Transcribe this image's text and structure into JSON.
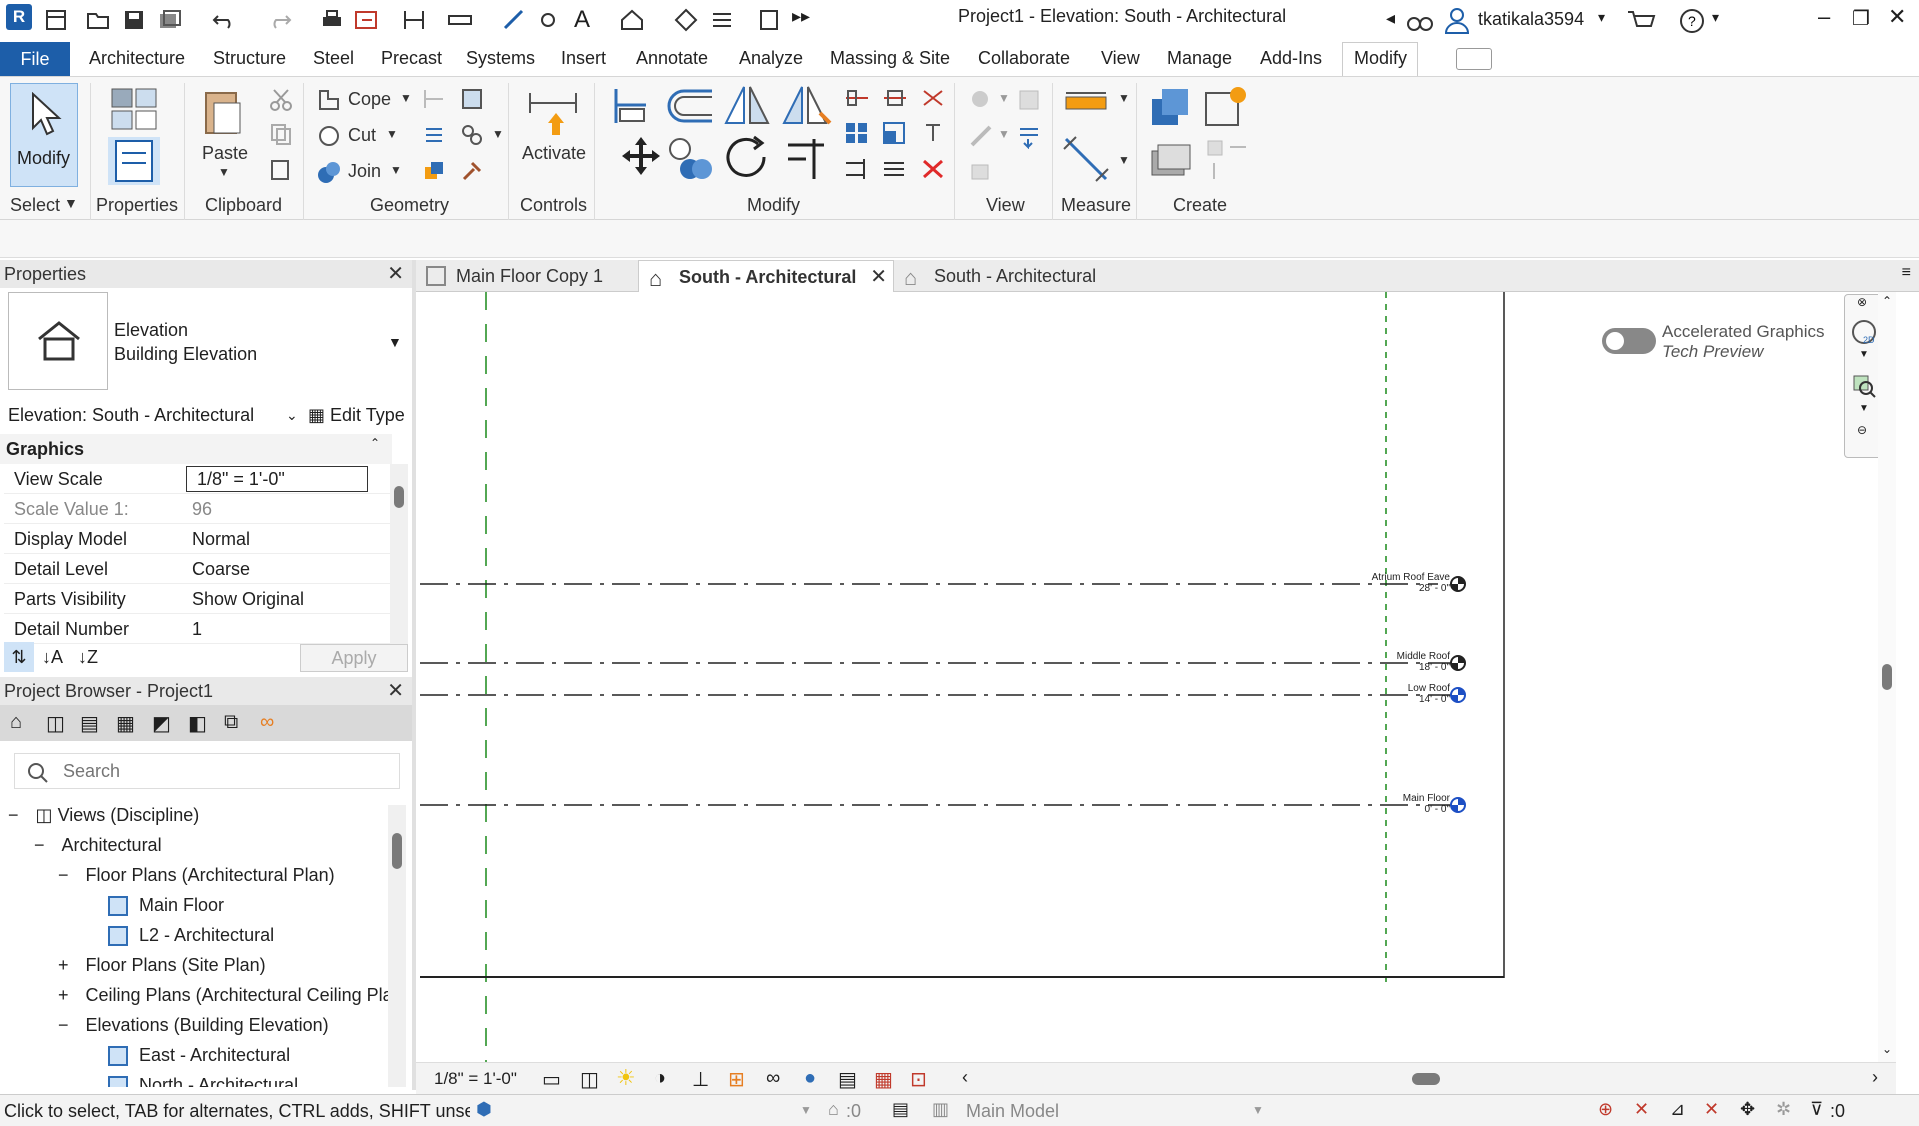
{
  "app": {
    "title": "Project1 - Elevation: South - Architectural",
    "user": "tkatikala3594"
  },
  "menu": {
    "file": "File",
    "items": [
      "Architecture",
      "Structure",
      "Steel",
      "Precast",
      "Systems",
      "Insert",
      "Annotate",
      "Analyze",
      "Massing & Site",
      "Collaborate",
      "View",
      "Manage",
      "Add-Ins",
      "Modify"
    ],
    "active": "Modify"
  },
  "ribbon": {
    "modify_btn": "Modify",
    "select": "Select",
    "properties": "Properties",
    "paste": "Paste",
    "clipboard": "Clipboard",
    "cope": "Cope",
    "cut": "Cut",
    "join": "Join",
    "geometry": "Geometry",
    "activate": "Activate",
    "controls": "Controls",
    "modify_panel": "Modify",
    "view": "View",
    "measure": "Measure",
    "create": "Create"
  },
  "properties": {
    "header": "Properties",
    "type_name": "Elevation",
    "type_sub": "Building Elevation",
    "instance": "Elevation: South - Architectural",
    "edit_type": "Edit Type",
    "group": "Graphics",
    "rows": [
      {
        "key": "View Scale",
        "value": "1/8\" = 1'-0\""
      },
      {
        "key": "Scale Value    1:",
        "value": "96"
      },
      {
        "key": "Display Model",
        "value": "Normal"
      },
      {
        "key": "Detail Level",
        "value": "Coarse"
      },
      {
        "key": "Parts Visibility",
        "value": "Show Original"
      },
      {
        "key": "Detail Number",
        "value": "1"
      }
    ],
    "apply": "Apply"
  },
  "browser": {
    "header": "Project Browser - Project1",
    "search_placeholder": "Search",
    "tree": [
      {
        "label": "Views (Discipline)",
        "depth": 0,
        "toggle": "−"
      },
      {
        "label": "Architectural",
        "depth": 1,
        "toggle": "−"
      },
      {
        "label": "Floor Plans (Architectural Plan)",
        "depth": 2,
        "toggle": "−"
      },
      {
        "label": "Main Floor",
        "depth": 3,
        "toggle": ""
      },
      {
        "label": "L2 - Architectural",
        "depth": 3,
        "toggle": ""
      },
      {
        "label": "Floor Plans (Site Plan)",
        "depth": 2,
        "toggle": "+"
      },
      {
        "label": "Ceiling Plans (Architectural Ceiling Pla",
        "depth": 2,
        "toggle": "+"
      },
      {
        "label": "Elevations (Building Elevation)",
        "depth": 2,
        "toggle": "−"
      },
      {
        "label": "East - Architectural",
        "depth": 3,
        "toggle": ""
      },
      {
        "label": "North - Architectural",
        "depth": 3,
        "toggle": ""
      }
    ]
  },
  "tabs": [
    {
      "label": "Main Floor Copy 1",
      "active": false
    },
    {
      "label": "South - Architectural",
      "active": true
    },
    {
      "label": "South - Architectural",
      "active": false
    }
  ],
  "canvas": {
    "toggle_label": "Accelerated Graphics",
    "toggle_sub": "Tech Preview",
    "levels": [
      {
        "name": "Atrium Roof Eave",
        "elev": "28' - 0\""
      },
      {
        "name": "Middle Roof",
        "elev": "18' - 0\""
      },
      {
        "name": "Low Roof",
        "elev": "14' - 0\""
      },
      {
        "name": "Main Floor",
        "elev": "0' - 0\""
      }
    ]
  },
  "viewbar": {
    "scale": "1/8\" = 1'-0\""
  },
  "status": {
    "hint": "Click to select, TAB for alternates, CTRL adds, SHIFT unselect",
    "count": ":0",
    "model": "Main Model",
    "filter_count": ":0"
  }
}
